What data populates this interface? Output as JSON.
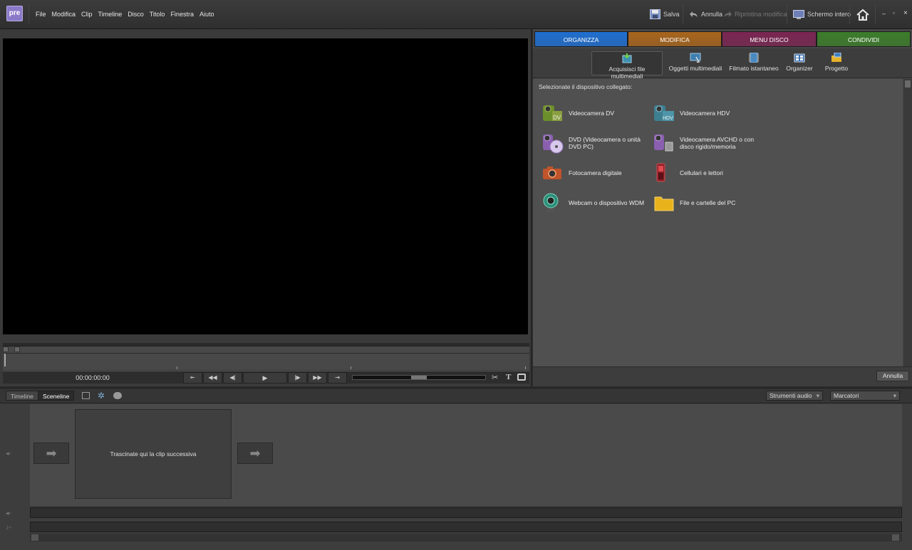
{
  "app": {
    "logo": "pre"
  },
  "menu": [
    "File",
    "Modifica",
    "Clip",
    "Timeline",
    "Disco",
    "Titolo",
    "Finestra",
    "Aiuto"
  ],
  "toolbar": {
    "save": "Salva",
    "undo": "Annulla",
    "redo": "Ripristina modifica",
    "fullscreen": "Schermo intero"
  },
  "monitor": {
    "timecode": "00:00:00:00"
  },
  "tabs": [
    {
      "label": "ORGANIZZA",
      "color": "#1f6fd1"
    },
    {
      "label": "MODIFICA",
      "color": "#a8651c"
    },
    {
      "label": "MENU DISCO",
      "color": "#7b2652"
    },
    {
      "label": "CONDIVIDI",
      "color": "#3c7d2b"
    }
  ],
  "subtoolbar": [
    {
      "label": "Acquisisci file multimediali",
      "icon": "capture-icon",
      "selected": true
    },
    {
      "label": "Oggetti multimediali",
      "icon": "media-icon"
    },
    {
      "label": "Filmato istantaneo",
      "icon": "filmstrip-icon"
    },
    {
      "label": "Organizer",
      "icon": "organizer-icon"
    },
    {
      "label": "Progetto",
      "icon": "project-icon"
    }
  ],
  "devices": {
    "title": "Selezionate il dispositivo collegato:",
    "items": [
      {
        "label": "Videocamera DV",
        "icon": "dv-camera-icon"
      },
      {
        "label": "Videocamera HDV",
        "icon": "hdv-camera-icon"
      },
      {
        "label": "DVD (Videocamera o unità DVD PC)",
        "icon": "dvd-icon"
      },
      {
        "label": "Videocamera AVCHD o con disco rigido/memoria",
        "icon": "avchd-camera-icon"
      },
      {
        "label": "Fotocamera digitale",
        "icon": "photo-camera-icon"
      },
      {
        "label": "Cellulari e lettori",
        "icon": "phone-icon"
      },
      {
        "label": "Webcam o dispositivo WDM",
        "icon": "webcam-icon"
      },
      {
        "label": "File e cartelle del PC",
        "icon": "folder-icon"
      }
    ]
  },
  "panel": {
    "cancel": "Annulla"
  },
  "bottom": {
    "tabs": [
      "Timeline",
      "Sceneline"
    ],
    "audio_tools": "Strumenti audio",
    "markers": "Marcatori",
    "dropzone": "Trascinate qui la clip successiva"
  }
}
